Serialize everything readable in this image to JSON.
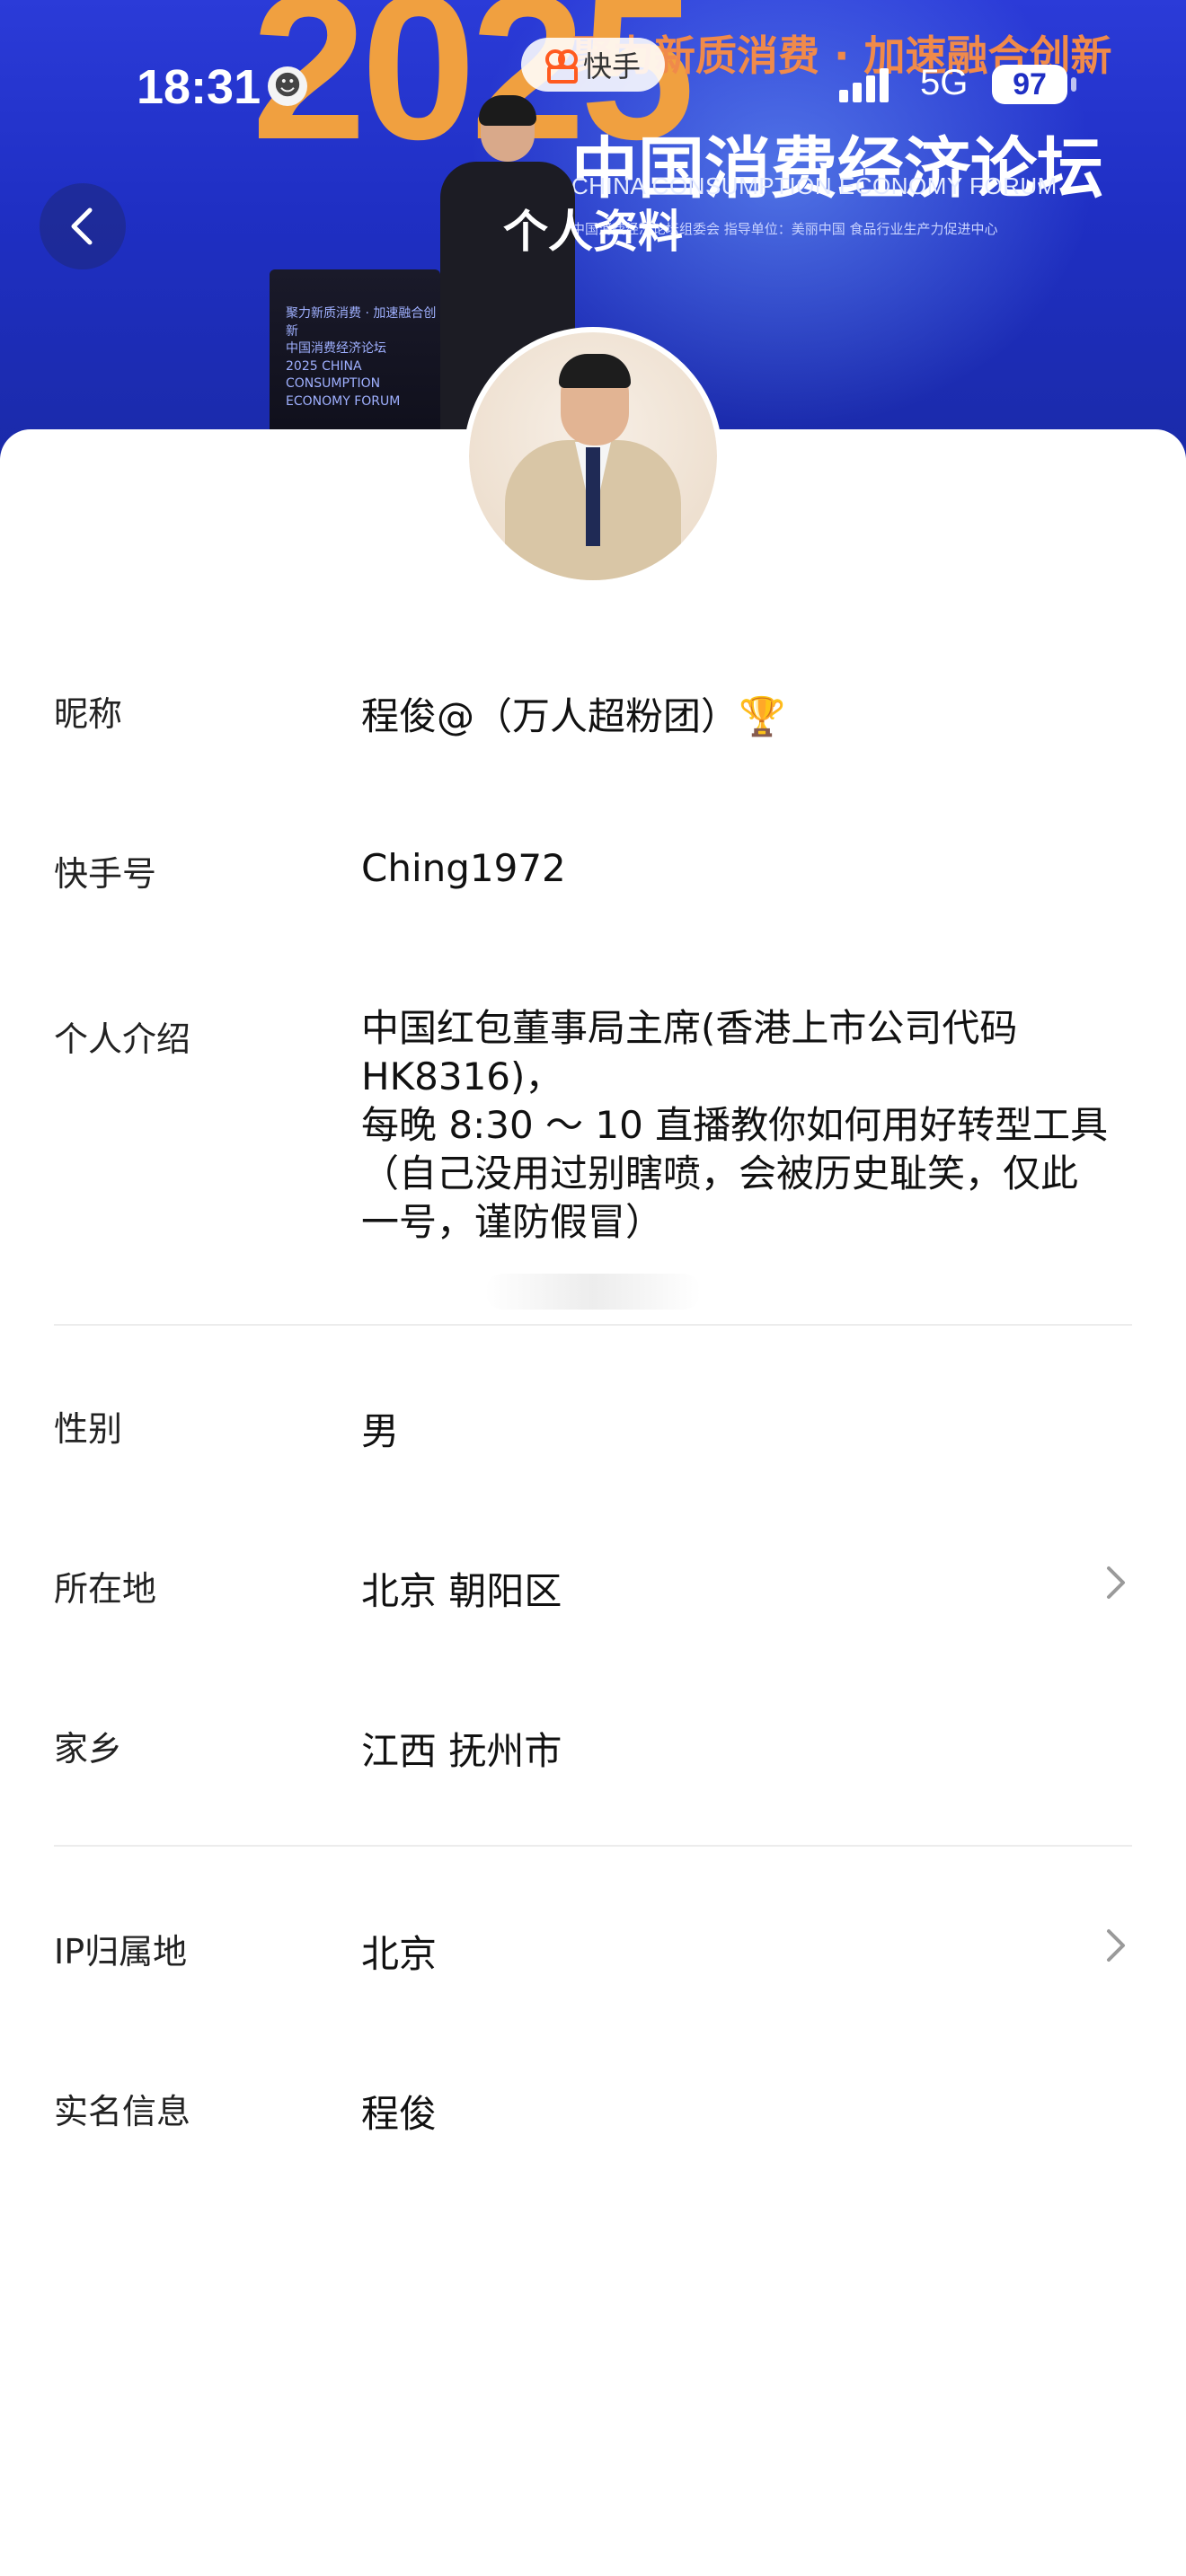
{
  "status_bar": {
    "time": "18:31",
    "emoji": "☻",
    "network": "5G",
    "battery": "97"
  },
  "app_pill": {
    "name": "快手"
  },
  "banner": {
    "year": "2025",
    "slogan": "聚力新质消费 · 加速融合创新",
    "forum_cn": "中国消费经济论坛",
    "forum_en": "CHINA CONSUMPTION ECONOMY FORUM",
    "host_line": "中国消费经济论坛组委会    指导单位：美丽中国 食品行业生产力促进中心",
    "podium_text": "聚力新质消费 · 加速融合创新\n中国消费经济论坛\n2025 CHINA CONSUMPTION\nECONOMY FORUM"
  },
  "nav": {
    "title": "个人资料"
  },
  "profile": {
    "nickname_label": "昵称",
    "nickname_value": "程俊@（万人超粉团）🏆",
    "id_label": "快手号",
    "id_value": "Ching1972",
    "bio_label": "个人介绍",
    "bio_value": "中国红包董事局主席(香港上市公司代码\n HK8316)，\n每晚 8:30 ～ 10 直播教你如何用好转型工具\n（自己没用过别瞎喷，会被历史耻笑，仅此\n一号，谨防假冒）",
    "gender_label": "性别",
    "gender_value": "男",
    "location_label": "所在地",
    "location_value": "北京 朝阳区",
    "hometown_label": "家乡",
    "hometown_value": "江西 抚州市",
    "ip_label": "IP归属地",
    "ip_value": "北京",
    "realname_label": "实名信息",
    "realname_value": "程俊"
  },
  "icons": {
    "back": "chevron-left-icon",
    "row_arrow": "chevron-right-icon",
    "app_logo": "kuaishou-logo-icon",
    "signal": "signal-icon",
    "battery": "battery-icon"
  },
  "colors": {
    "banner_blue": "#1f2fc4",
    "accent_orange": "#ff5a1f",
    "year_orange": "#f0a040"
  }
}
